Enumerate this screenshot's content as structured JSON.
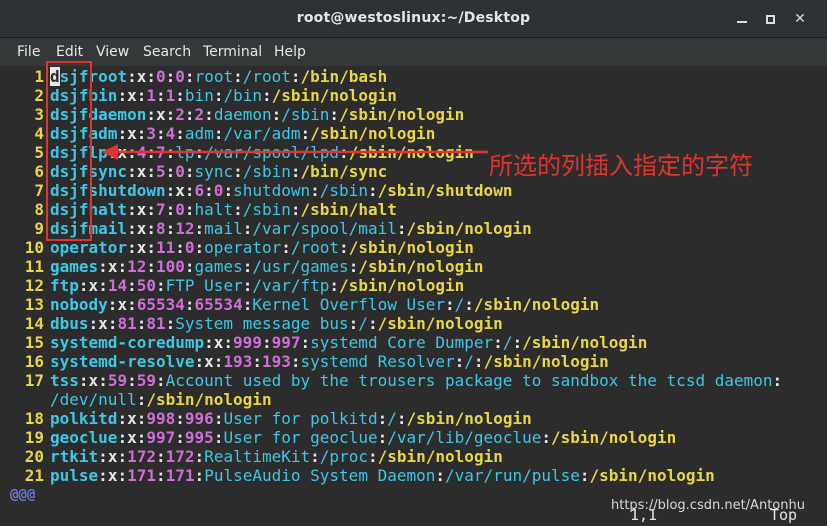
{
  "window": {
    "title": "root@westoslinux:~/Desktop"
  },
  "menu": [
    "File",
    "Edit",
    "View",
    "Search",
    "Terminal",
    "Help"
  ],
  "lines": [
    {
      "n": "1",
      "prefix": "dsjf",
      "name": "root",
      "uid": "0",
      "gid": "0",
      "gecos": "root",
      "home": "/root",
      "shell": "/bin/bash"
    },
    {
      "n": "2",
      "prefix": "dsjf",
      "name": "bin",
      "uid": "1",
      "gid": "1",
      "gecos": "bin",
      "home": "/bin",
      "shell": "/sbin/nologin"
    },
    {
      "n": "3",
      "prefix": "dsjf",
      "name": "daemon",
      "uid": "2",
      "gid": "2",
      "gecos": "daemon",
      "home": "/sbin",
      "shell": "/sbin/nologin"
    },
    {
      "n": "4",
      "prefix": "dsjf",
      "name": "adm",
      "uid": "3",
      "gid": "4",
      "gecos": "adm",
      "home": "/var/adm",
      "shell": "/sbin/nologin"
    },
    {
      "n": "5",
      "prefix": "dsjf",
      "name": "lp",
      "uid": "4",
      "gid": "7",
      "gecos": "lp",
      "home": "/var/spool/lpd",
      "shell": "/sbin/nologin"
    },
    {
      "n": "6",
      "prefix": "dsjf",
      "name": "sync",
      "uid": "5",
      "gid": "0",
      "gecos": "sync",
      "home": "/sbin",
      "shell": "/bin/sync"
    },
    {
      "n": "7",
      "prefix": "dsjf",
      "name": "shutdown",
      "uid": "6",
      "gid": "0",
      "gecos": "shutdown",
      "home": "/sbin",
      "shell": "/sbin/shutdown"
    },
    {
      "n": "8",
      "prefix": "dsjf",
      "name": "halt",
      "uid": "7",
      "gid": "0",
      "gecos": "halt",
      "home": "/sbin",
      "shell": "/sbin/halt"
    },
    {
      "n": "9",
      "prefix": "dsjf",
      "name": "mail",
      "uid": "8",
      "gid": "12",
      "gecos": "mail",
      "home": "/var/spool/mail",
      "shell": "/sbin/nologin"
    },
    {
      "n": "10",
      "prefix": "",
      "name": "operator",
      "uid": "11",
      "gid": "0",
      "gecos": "operator",
      "home": "/root",
      "shell": "/sbin/nologin"
    },
    {
      "n": "11",
      "prefix": "",
      "name": "games",
      "uid": "12",
      "gid": "100",
      "gecos": "games",
      "home": "/usr/games",
      "shell": "/sbin/nologin"
    },
    {
      "n": "12",
      "prefix": "",
      "name": "ftp",
      "uid": "14",
      "gid": "50",
      "gecos": "FTP User",
      "home": "/var/ftp",
      "shell": "/sbin/nologin"
    },
    {
      "n": "13",
      "prefix": "",
      "name": "nobody",
      "uid": "65534",
      "gid": "65534",
      "gecos": "Kernel Overflow User",
      "home": "/",
      "shell": "/sbin/nologin"
    },
    {
      "n": "14",
      "prefix": "",
      "name": "dbus",
      "uid": "81",
      "gid": "81",
      "gecos": "System message bus",
      "home": "/",
      "shell": "/sbin/nologin"
    },
    {
      "n": "15",
      "prefix": "",
      "name": "systemd-coredump",
      "uid": "999",
      "gid": "997",
      "gecos": "systemd Core Dumper",
      "home": "/",
      "shell": "/sbin/nologin"
    },
    {
      "n": "16",
      "prefix": "",
      "name": "systemd-resolve",
      "uid": "193",
      "gid": "193",
      "gecos": "systemd Resolver",
      "home": "/",
      "shell": "/sbin/nologin"
    },
    {
      "n": "17",
      "prefix": "",
      "name": "tss",
      "uid": "59",
      "gid": "59",
      "gecos": "Account used by the trousers package to sandbox the tcsd daemon",
      "home": "",
      "shell": ""
    },
    {
      "n": "",
      "prefix": "",
      "name": "",
      "uid": "",
      "gid": "",
      "gecos": "",
      "home": "/dev/null",
      "shell": "/sbin/nologin",
      "continuation": true
    },
    {
      "n": "18",
      "prefix": "",
      "name": "polkitd",
      "uid": "998",
      "gid": "996",
      "gecos": "User for polkitd",
      "home": "/",
      "shell": "/sbin/nologin"
    },
    {
      "n": "19",
      "prefix": "",
      "name": "geoclue",
      "uid": "997",
      "gid": "995",
      "gecos": "User for geoclue",
      "home": "/var/lib/geoclue",
      "shell": "/sbin/nologin"
    },
    {
      "n": "20",
      "prefix": "",
      "name": "rtkit",
      "uid": "172",
      "gid": "172",
      "gecos": "RealtimeKit",
      "home": "/proc",
      "shell": "/sbin/nologin"
    },
    {
      "n": "21",
      "prefix": "",
      "name": "pulse",
      "uid": "171",
      "gid": "171",
      "gecos": "PulseAudio System Daemon",
      "home": "/var/run/pulse",
      "shell": "/sbin/nologin"
    }
  ],
  "tilde_marker": "@@@",
  "status": {
    "position": "1,1",
    "scroll": "Top"
  },
  "annotation": {
    "text": "所选的列插入指定的字符",
    "color": "#e0342e"
  },
  "watermark": "https://blog.csdn.net/Antonhu",
  "colors": {
    "line_number": "#e8d64a",
    "username": "#3ec7e6",
    "numbers": "#d06ed8",
    "shell": "#e8d64a",
    "background": "#2c2c2c"
  }
}
